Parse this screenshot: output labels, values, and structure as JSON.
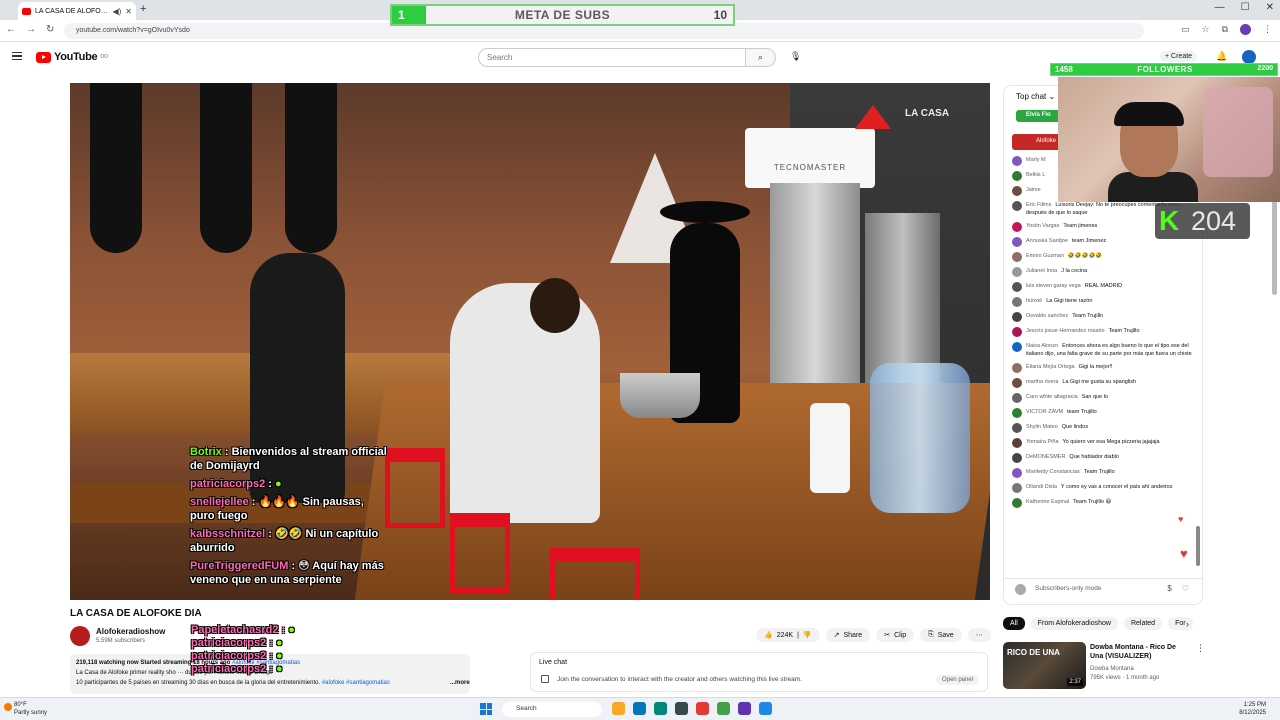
{
  "browser": {
    "tab_title": "LA CASA DE ALOFOKE DIA",
    "url": "youtube.com/watch?v=gOIvu0vYsdo"
  },
  "meta_subs": {
    "left_value": "1",
    "label": "META DE SUBS",
    "right_value": "10",
    "progress": 0.1
  },
  "youtube": {
    "logo": "YouTube",
    "logo_sup": "DO",
    "search_placeholder": "Search",
    "create_label": "Create"
  },
  "video_overlay": {
    "brand": "LA CASA",
    "sign": "TECNOMASTER",
    "chat": [
      {
        "user": "Botrix",
        "text": "Bienvenidos al stream official de Domijayrd"
      },
      {
        "user": "patriciacorps2",
        "text": ""
      },
      {
        "user": "snellejellee",
        "text": "Sin pausas, puro fuego"
      },
      {
        "user": "kalbsschnitzel",
        "text": "Ni un capítulo aburrido"
      },
      {
        "user": "PureTriggeredFUM",
        "text": "Aquí hay más veneno que en una serpiente"
      }
    ],
    "lower_names": [
      "Papeletachasrd2",
      "patriciacorps2",
      "patriciacorps2",
      "patriciacorps2"
    ]
  },
  "video_info": {
    "title": "LA CASA DE ALOFOKE DIA",
    "channel": "Alofokeradioshow",
    "subscribers": "5.59M subscribers",
    "likes": "224K",
    "share": "Share",
    "clip": "Clip",
    "save": "Save",
    "desc_stats": "219,118 watching now  Started streaming 18 hours ago",
    "desc_tags1": "#alofoke #santiagomatias",
    "desc_line2": "La Casa de Alofoke primer reality sho",
    "desc_line2b": "ducido por Alofoke Media Group.",
    "desc_line3": "10 participantes de 5 países en streaming 30 días en busca de la gloria del entretenimiento.",
    "desc_tags2": "#alofoke #santiagomatias",
    "more": "...more"
  },
  "live_chat_box": {
    "title": "Live chat",
    "text": "Join the conversation to interact with the creator and others watching this live stream.",
    "open_panel": "Open panel"
  },
  "chat_panel": {
    "top_chat": "Top chat",
    "pinned_user": "Elvis Flo",
    "pinned_red": "Alofoke",
    "messages": [
      {
        "name": "Marly M",
        "text": "",
        "color": "#7e57c2"
      },
      {
        "name": "Belkis L",
        "text": "",
        "color": "#2e7d32"
      },
      {
        "name": "Jaime",
        "text": "",
        "color": "#6d4c41"
      },
      {
        "name": "Eric Filims",
        "text": "Luisoris Deejay: No te preocupes comentarás poco después de que lo saque",
        "color": "#555555"
      },
      {
        "name": "Yostin Vargas",
        "text": "Team jimenes",
        "color": "#c2185b"
      },
      {
        "name": "Annuska Sardjoe",
        "text": "team Jimenez",
        "color": "#7e57c2"
      },
      {
        "name": "Emnio Guzman",
        "text": "🤣🤣🤣🤣🤣",
        "color": "#8d6e63"
      },
      {
        "name": "Julianet Inoa",
        "text": "J la cocina",
        "color": "#999999"
      },
      {
        "name": "luis steven garay vega",
        "text": "REAL MADRID",
        "color": "#555555"
      },
      {
        "name": "hünxiè",
        "text": "La Gigi tiene razón",
        "color": "#777777"
      },
      {
        "name": "Osvaldo sanchez",
        "text": "Team Trujillo",
        "color": "#444444"
      },
      {
        "name": "Jescris josue Hernandez rosario",
        "text": "Team Trujillo",
        "color": "#ad1457"
      },
      {
        "name": "Naisa Alonzo",
        "text": "Entonces ahora es algo bueno lo que el tipo ese del italiano dijo, una falta grave de su parte por más que fuera un chiste",
        "color": "#1565c0"
      },
      {
        "name": "Eliana Mejía Ortega",
        "text": "Gigi la mejor!!",
        "color": "#8d6e63"
      },
      {
        "name": "martha rivera",
        "text": "La Gigi me gusta su spanglish",
        "color": "#6d4c41"
      },
      {
        "name": "Caro white altagracia",
        "text": "San que lo",
        "color": "#666666"
      },
      {
        "name": "VICTOR ZAVM",
        "text": "team Trujillo",
        "color": "#2e7d32"
      },
      {
        "name": "Shylin Mateo",
        "text": "Que lindos",
        "color": "#555555"
      },
      {
        "name": "Yomaira Piña",
        "text": "Yo quiero ver esa Mega pizzeria jajajaja",
        "color": "#5d4037"
      },
      {
        "name": "DeMONESMER",
        "text": "Que hablador diablo",
        "color": "#444444"
      },
      {
        "name": "Marileidy Constancias",
        "text": "Team Trujillo",
        "color": "#7e57c2"
      },
      {
        "name": "Ollandi Disla",
        "text": "Y como ey vas a conocer el país ahí andetros",
        "color": "#777777"
      },
      {
        "name": "Katherine Espinal",
        "text": "Team Trujillo 😆",
        "color": "#2e7d32"
      }
    ],
    "input_placeholder": "Subscribers-only mode"
  },
  "related": {
    "chips": [
      "All",
      "From Alofokeradioshow",
      "Related",
      "For"
    ],
    "video_title": "Dowba Montana - Rico De Una (VISUALIZER)",
    "thumb_text": "RICO DE UNA",
    "duration": "2:37",
    "channel": "Dowba Montana",
    "meta": "795K views · 1 month ago"
  },
  "stream_overlay": {
    "followers_left": "1458",
    "followers_label": "FOLLOWERS",
    "followers_right": "2200",
    "kick_count": "204"
  },
  "taskbar": {
    "temp": "80°F",
    "weather": "Partly sunny",
    "search": "Search",
    "time": "1:25 PM",
    "date": "8/12/2025"
  }
}
